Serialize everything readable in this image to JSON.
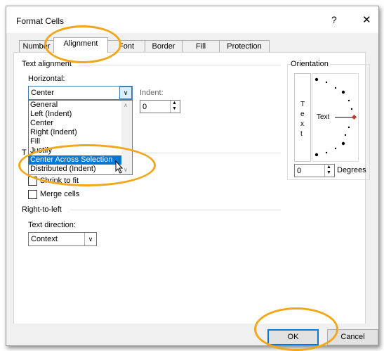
{
  "window": {
    "title": "Format Cells",
    "help": "?",
    "close": "✕"
  },
  "tabs": [
    {
      "label": "Number",
      "active": false
    },
    {
      "label": "Alignment",
      "active": true
    },
    {
      "label": "Font",
      "active": false
    },
    {
      "label": "Border",
      "active": false
    },
    {
      "label": "Fill",
      "active": false
    },
    {
      "label": "Protection",
      "active": false
    }
  ],
  "text_alignment": {
    "section": "Text alignment",
    "horizontal_label": "Horizontal:",
    "horizontal_value": "Center",
    "indent_label": "Indent:",
    "indent_value": "0",
    "horizontal_options": [
      "General",
      "Left (Indent)",
      "Center",
      "Right (Indent)",
      "Fill",
      "Justify",
      "Center Across Selection",
      "Distributed (Indent)"
    ],
    "selected_option": "Center Across Selection"
  },
  "text_control": {
    "shrink_to_fit": "Shrink to fit",
    "merge_cells": "Merge cells"
  },
  "rtl": {
    "section": "Right-to-left",
    "direction_label": "Text direction:",
    "direction_value": "Context"
  },
  "orientation": {
    "section": "Orientation",
    "vertical_text": [
      "T",
      "e",
      "x",
      "t"
    ],
    "dial_text": "Text",
    "degrees_value": "0",
    "degrees_label": "Degrees"
  },
  "buttons": {
    "ok": "OK",
    "cancel": "Cancel"
  },
  "colors": {
    "highlight": "#f2a71a",
    "selection": "#0078d7",
    "focus": "#3c7fb1"
  }
}
